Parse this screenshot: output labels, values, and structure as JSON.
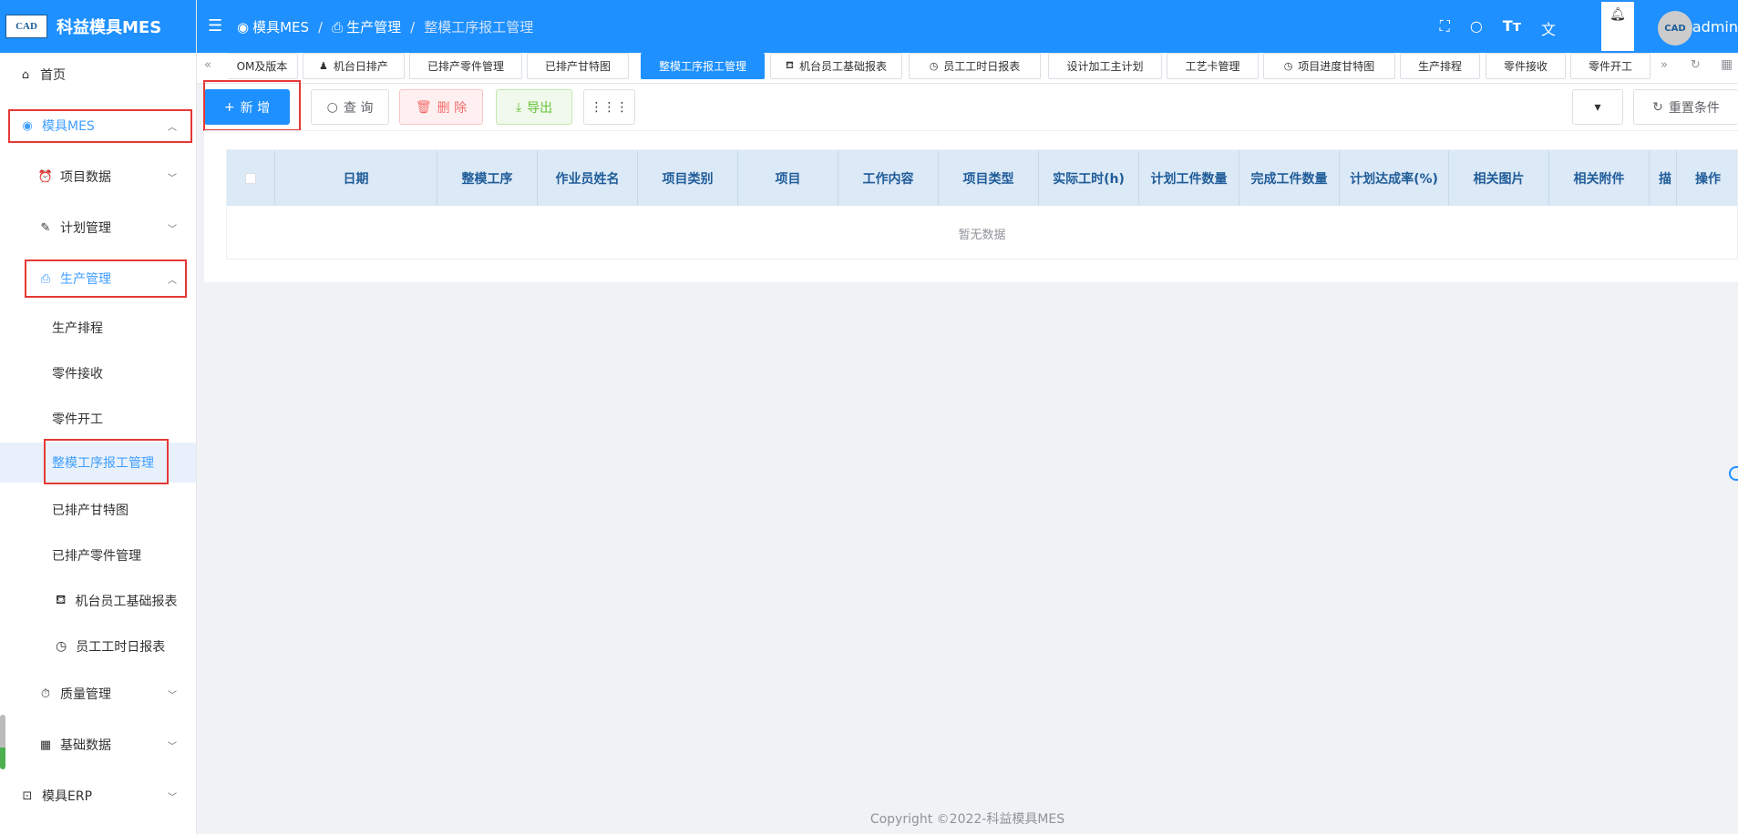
{
  "app": {
    "logo_text": "CAD",
    "title": "科益模具MES"
  },
  "sidebar": {
    "home": "首页",
    "mes": "模具MES",
    "project_data": "项目数据",
    "plan_mgmt": "计划管理",
    "production_mgmt": "生产管理",
    "sub_items": [
      "生产排程",
      "零件接收",
      "零件开工",
      "整模工序报工管理",
      "已排产甘特图",
      "已排产零件管理",
      "机台员工基础报表",
      "员工工时日报表"
    ],
    "quality_mgmt": "质量管理",
    "base_data": "基础数据",
    "erp": "模具ERP"
  },
  "header": {
    "breadcrumb": [
      "模具MES",
      "生产管理",
      "整模工序报工管理"
    ],
    "user": "admin",
    "avatar_text": "CAD"
  },
  "tabs": [
    "OM及版本",
    "机台日排产",
    "已排产零件管理",
    "已排产甘特图",
    "整模工序报工管理",
    "机台员工基础报表",
    "员工工时日报表",
    "设计加工主计划",
    "工艺卡管理",
    "项目进度甘特图",
    "生产排程",
    "零件接收",
    "零件开工"
  ],
  "toolbar": {
    "add": "新 增",
    "query": "查 询",
    "delete": "删 除",
    "export": "导出",
    "reset": "重置条件"
  },
  "table": {
    "columns": [
      "日期",
      "整模工序",
      "作业员姓名",
      "项目类别",
      "项目",
      "工作内容",
      "项目类型",
      "实际工时(h)",
      "计划工件数量",
      "完成工件数量",
      "计划达成率(%)",
      "相关图片",
      "相关附件",
      "描",
      "操作"
    ],
    "empty_text": "暂无数据"
  },
  "footer": "Copyright ©2022-科益模具MES"
}
